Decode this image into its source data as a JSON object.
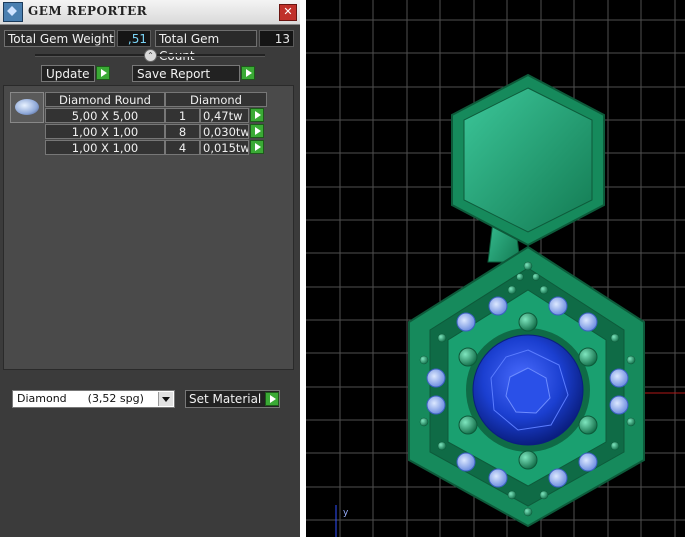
{
  "window": {
    "title": "GEM REPORTER",
    "close_glyph": "✕"
  },
  "stats": {
    "weight_label": "Total Gem Weight",
    "weight_value": ",51",
    "count_label": "Total Gem Count",
    "count_value": "13"
  },
  "divider_glyph": "⌃",
  "buttons": {
    "update": "Update",
    "save_report": "Save Report",
    "set_material": "Set Material"
  },
  "table": {
    "header": [
      "Diamond Round",
      "Diamond"
    ],
    "rows": [
      {
        "size": "5,00 X 5,00",
        "count": "1",
        "weight": "0,47tw"
      },
      {
        "size": "1,00 X 1,00",
        "count": "8",
        "weight": "0,030tw"
      },
      {
        "size": "1,00 X 1,00",
        "count": "4",
        "weight": "0,015tw"
      }
    ]
  },
  "material": {
    "selected": "Diamond      (3,52 spg)"
  },
  "viewport": {
    "axis_label": "y"
  },
  "colors": {
    "metal": "#1f9e6c",
    "metal_light": "#3cc79a",
    "sapphire": "#1b3fd0",
    "accent_diamond": "#8fb3ff",
    "grid": "#4f4f4f"
  },
  "icons": [
    "app-icon",
    "close-icon",
    "collapse-icon",
    "play-icon",
    "dropdown-arrow-icon",
    "gem-thumbnail-icon"
  ]
}
